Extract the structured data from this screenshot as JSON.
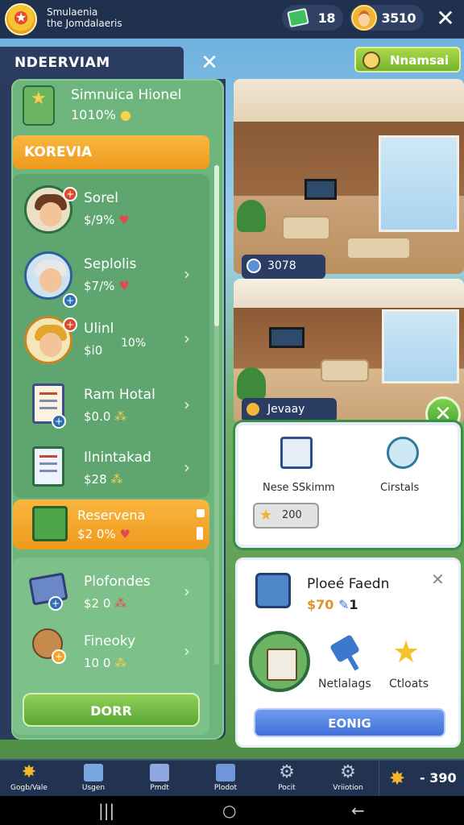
{
  "header": {
    "app_title_line1": "Smulaenia",
    "app_title_line2": "the Jomdalaeris",
    "cash": "18",
    "coins": "3510"
  },
  "panel": {
    "title": "NDEERVIAM",
    "name_button": "Nnamsai",
    "profile_name": "Simnuica Hionel",
    "profile_value": "1010%",
    "section": "KOREVIA",
    "rows": [
      {
        "name": "Sorel",
        "value": "$/9%"
      },
      {
        "name": "Seplolis",
        "value": "$7/%"
      },
      {
        "name": "Ulinl",
        "value": "$i0",
        "extra": "10%"
      },
      {
        "name": "Ram Hotal",
        "value": "$0.0"
      },
      {
        "name": "Ilnintakad",
        "value": "$28"
      }
    ],
    "reserve": {
      "name": "Reservena",
      "value": "$2 0%"
    },
    "rows2": [
      {
        "name": "Plofondes",
        "value": "$2 0"
      },
      {
        "name": "Fineoky",
        "value": "10 0"
      }
    ],
    "action_button": "DORR"
  },
  "photos": {
    "tag1": "3078",
    "tag2": "Jevaay"
  },
  "card1": {
    "label_left": "Nese SSkimm",
    "label_right": "Cirstals",
    "cost": "200"
  },
  "card2": {
    "title": "Ploeé Faedn",
    "sub": "$70",
    "sub_extra": "1",
    "label_left": "Netlalags",
    "label_right": "Ctloats",
    "button": "EONIG"
  },
  "nav": [
    {
      "label": "Gogb/Vale"
    },
    {
      "label": "Usgen"
    },
    {
      "label": "Pmdt"
    },
    {
      "label": "Plodot"
    },
    {
      "label": "Pocit"
    },
    {
      "label": "Vriiotion"
    }
  ],
  "nav_stat": "- 390",
  "colors": {
    "panel_green": "#6db57c",
    "orange": "#f9b640",
    "accent_blue": "#3f6fd8"
  }
}
